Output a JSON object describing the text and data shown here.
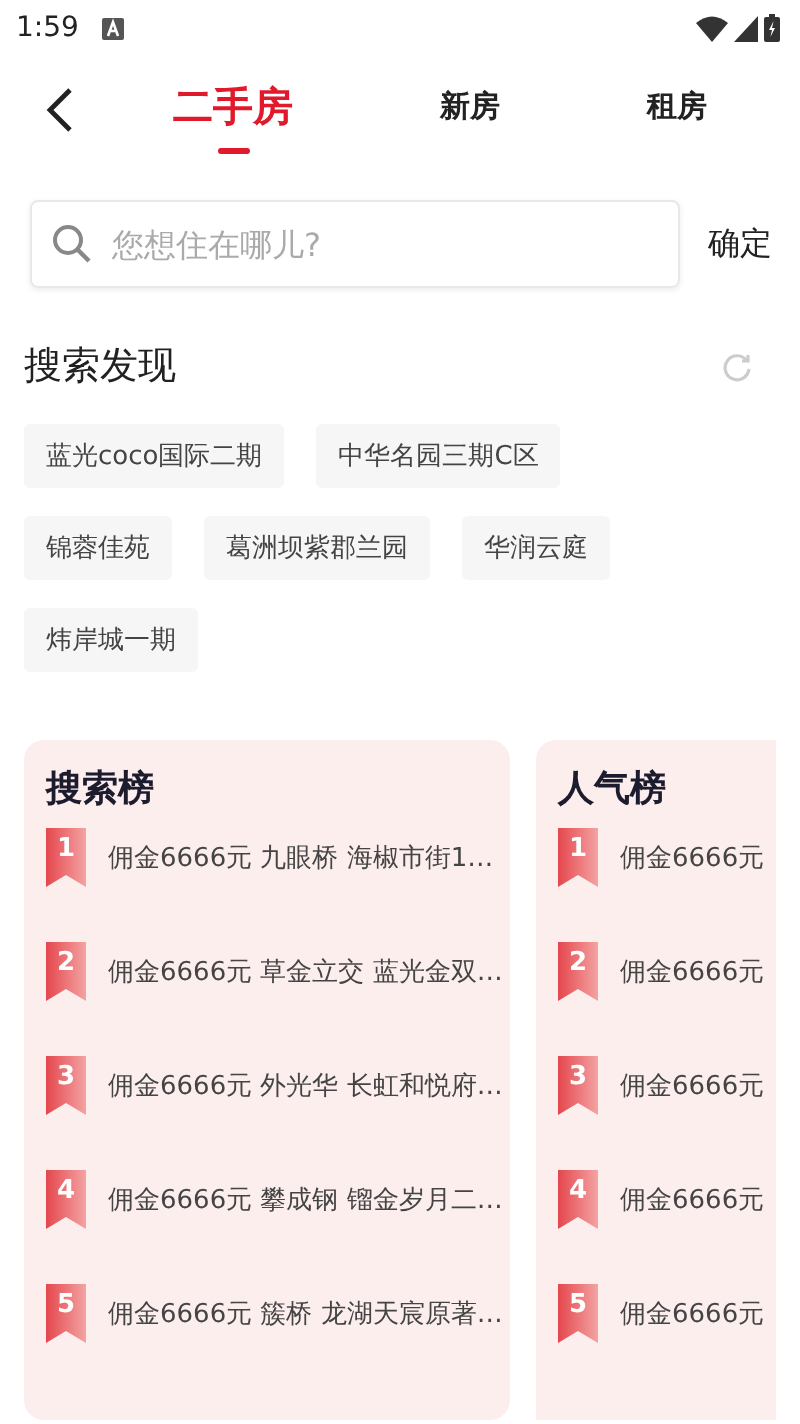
{
  "status_bar": {
    "time": "1:59"
  },
  "tabs": [
    {
      "label": "二手房",
      "selected": true
    },
    {
      "label": "新房",
      "selected": false
    },
    {
      "label": "租房",
      "selected": false
    }
  ],
  "search": {
    "placeholder": "您想住在哪儿?",
    "confirm": "确定"
  },
  "discover": {
    "title": "搜索发现",
    "tags": [
      "蓝光coco国际二期",
      "中华名园三期C区",
      "锦蓉佳苑",
      "葛洲坝紫郡兰园",
      "华润云庭",
      "炜岸城一期"
    ]
  },
  "rankings": [
    {
      "title": "搜索榜",
      "items": [
        {
          "rank": "1",
          "text": "佣金6666元 九眼桥 海椒市街1…"
        },
        {
          "rank": "2",
          "text": "佣金6666元 草金立交 蓝光金双…"
        },
        {
          "rank": "3",
          "text": "佣金6666元 外光华 长虹和悦府…"
        },
        {
          "rank": "4",
          "text": "佣金6666元 攀成钢 镏金岁月二…"
        },
        {
          "rank": "5",
          "text": "佣金6666元 簇桥 龙湖天宸原著…"
        }
      ]
    },
    {
      "title": "人气榜",
      "items": [
        {
          "rank": "1",
          "text": "佣金6666元"
        },
        {
          "rank": "2",
          "text": "佣金6666元"
        },
        {
          "rank": "3",
          "text": "佣金6666元"
        },
        {
          "rank": "4",
          "text": "佣金6666元"
        },
        {
          "rank": "5",
          "text": "佣金6666元"
        }
      ]
    }
  ]
}
